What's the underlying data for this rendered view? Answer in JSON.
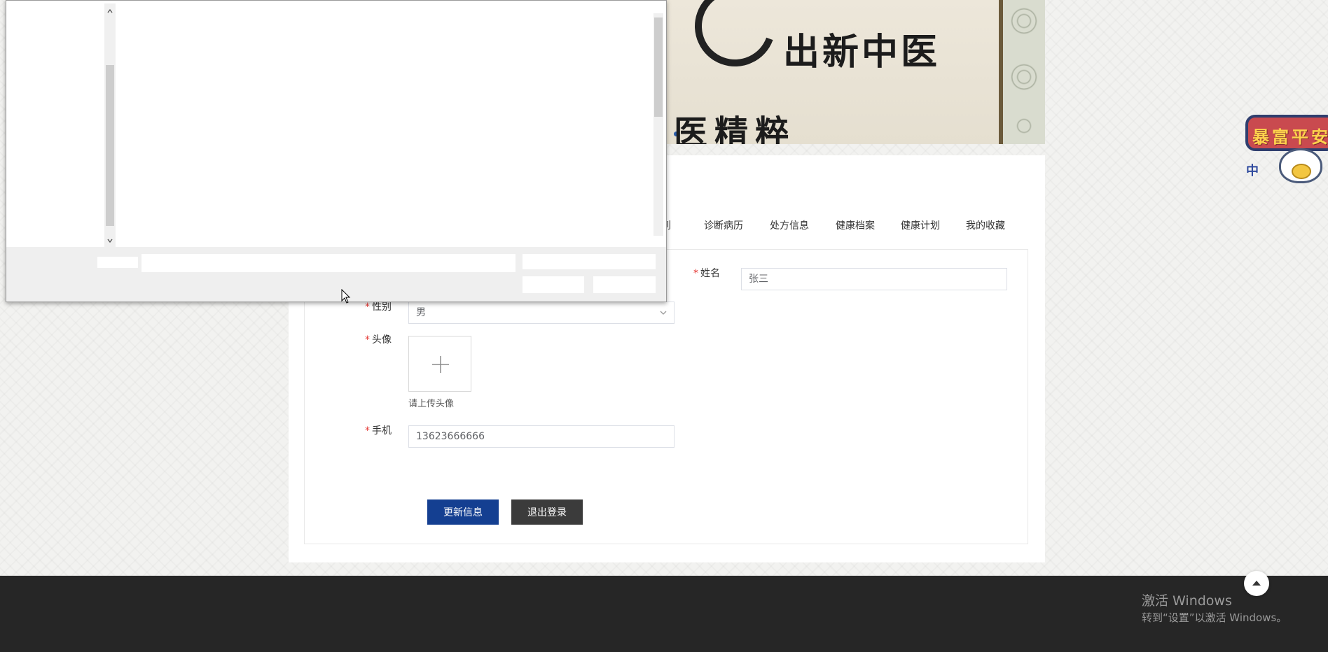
{
  "banner": {
    "title_line1": "出新中医",
    "title_line2": "医精粹"
  },
  "tabs": [
    {
      "label": "到"
    },
    {
      "label": "诊断病历"
    },
    {
      "label": "处方信息"
    },
    {
      "label": "健康档案"
    },
    {
      "label": "健康计划"
    },
    {
      "label": "我的收藏"
    }
  ],
  "form": {
    "required_mark": "*",
    "name": {
      "label": "姓名",
      "value": "张三"
    },
    "gender": {
      "label": "性别",
      "value": "男"
    },
    "avatar": {
      "label": "头像",
      "hint": "请上传头像"
    },
    "phone": {
      "label": "手机",
      "value": "13623666666"
    }
  },
  "buttons": {
    "update": "更新信息",
    "logout": "退出登录"
  },
  "badge": {
    "text": "暴富平安",
    "small": "中"
  },
  "watermark": {
    "line1": "激活 Windows",
    "line2": "转到“设置”以激活 Windows。"
  },
  "colors": {
    "primary": "#143f91",
    "dark_button": "#3b3b3b",
    "required": "#e53935",
    "footer": "#262626"
  }
}
